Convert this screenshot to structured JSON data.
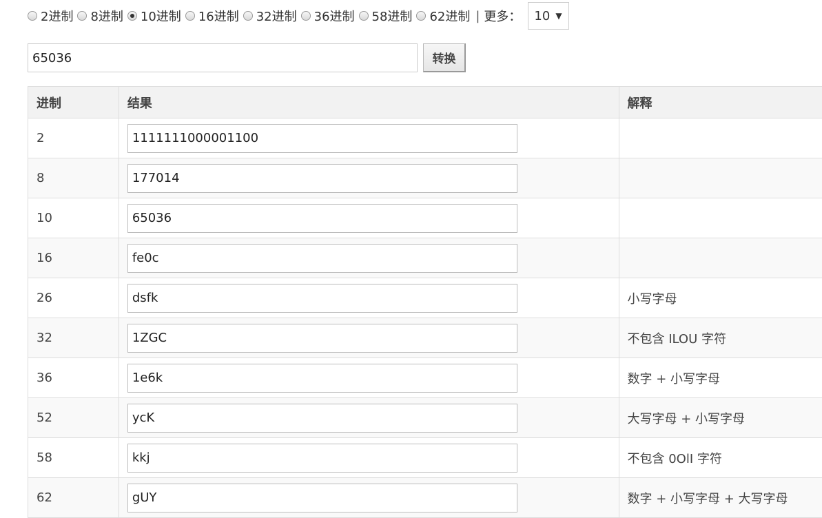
{
  "radix_options": [
    {
      "label": "2进制",
      "checked": false
    },
    {
      "label": "8进制",
      "checked": false
    },
    {
      "label": "10进制",
      "checked": true
    },
    {
      "label": "16进制",
      "checked": false
    },
    {
      "label": "32进制",
      "checked": false
    },
    {
      "label": "36进制",
      "checked": false
    },
    {
      "label": "58进制",
      "checked": false
    },
    {
      "label": "62进制",
      "checked": false
    }
  ],
  "divider": "|",
  "more": {
    "label": "更多：",
    "selected": "10"
  },
  "input": {
    "value": "65036"
  },
  "convert_button": "转换",
  "table": {
    "headers": [
      "进制",
      "结果",
      "解释"
    ],
    "rows": [
      {
        "base": "2",
        "result": "1111111000001100",
        "note": ""
      },
      {
        "base": "8",
        "result": "177014",
        "note": ""
      },
      {
        "base": "10",
        "result": "65036",
        "note": ""
      },
      {
        "base": "16",
        "result": "fe0c",
        "note": ""
      },
      {
        "base": "26",
        "result": "dsfk",
        "note": "小写字母"
      },
      {
        "base": "32",
        "result": "1ZGC",
        "note": "不包含 ILOU 字符"
      },
      {
        "base": "36",
        "result": "1e6k",
        "note": "数字 + 小写字母"
      },
      {
        "base": "52",
        "result": "ycK",
        "note": "大写字母 + 小写字母"
      },
      {
        "base": "58",
        "result": "kkj",
        "note": "不包含 0OlI 字符"
      },
      {
        "base": "62",
        "result": "gUY",
        "note": "数字 + 小写字母 + 大写字母"
      }
    ]
  }
}
